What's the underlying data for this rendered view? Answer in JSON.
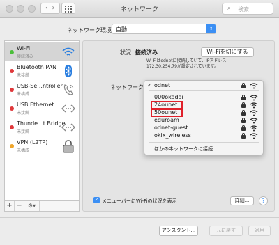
{
  "window": {
    "title": "ネットワーク",
    "search_placeholder": "検索",
    "search_icon": "magnifier-icon"
  },
  "location": {
    "label": "ネットワーク環境:",
    "value": "自動"
  },
  "sidebar": {
    "services": [
      {
        "name": "Wi-Fi",
        "sub": "接続済み",
        "status_color": "#4bbf3a",
        "icon": "wifi-icon",
        "selected": true
      },
      {
        "name": "Bluetooth PAN",
        "sub": "未接続",
        "status_color": "#e0383b",
        "icon": "bluetooth-icon",
        "selected": false
      },
      {
        "name": "USB-Se...ntroller",
        "sub": "未構成",
        "status_color": "#e0383b",
        "icon": "phone-icon",
        "selected": false
      },
      {
        "name": "USB Ethernet",
        "sub": "未接続",
        "status_color": "#e0383b",
        "icon": "ethernet-icon",
        "selected": false
      },
      {
        "name": "Thunde...t Bridge",
        "sub": "未接続",
        "status_color": "#e0383b",
        "icon": "ethernet-icon",
        "selected": false
      },
      {
        "name": "VPN (L2TP)",
        "sub": "未構成",
        "status_color": "#f0a62c",
        "icon": "vpn-lock-icon",
        "selected": false
      }
    ],
    "toolbar": {
      "add": "+",
      "remove": "−",
      "action": "⚙▾"
    }
  },
  "status": {
    "label": "状況:",
    "value": "接続済み",
    "description": "Wi-Fiはodnetに接続していて、IPアドレス 172.30.254.79が設定されています。",
    "wifi_off_button": "Wi-Fiを切にする"
  },
  "network_name": {
    "label": "ネットワーク名",
    "current": "odnet",
    "networks": [
      {
        "name": "000okadai",
        "locked": true,
        "highlighted": false
      },
      {
        "name": "24ounet",
        "locked": true,
        "highlighted": true
      },
      {
        "name": "50ounet",
        "locked": true,
        "highlighted": true
      },
      {
        "name": "eduroam",
        "locked": true,
        "highlighted": false
      },
      {
        "name": "odnet-guest",
        "locked": true,
        "highlighted": false
      },
      {
        "name": "okix_wireless",
        "locked": true,
        "highlighted": false
      }
    ],
    "other_network": "ほかのネットワークに接続..."
  },
  "menubar_option": {
    "checked": true,
    "label": "メニューバーにWi-Fiの状況を表示"
  },
  "advanced_button": "詳細...",
  "help_button": "?",
  "footer": {
    "assistant": "アシスタント...",
    "revert": "元に戻す",
    "apply": "適用"
  }
}
